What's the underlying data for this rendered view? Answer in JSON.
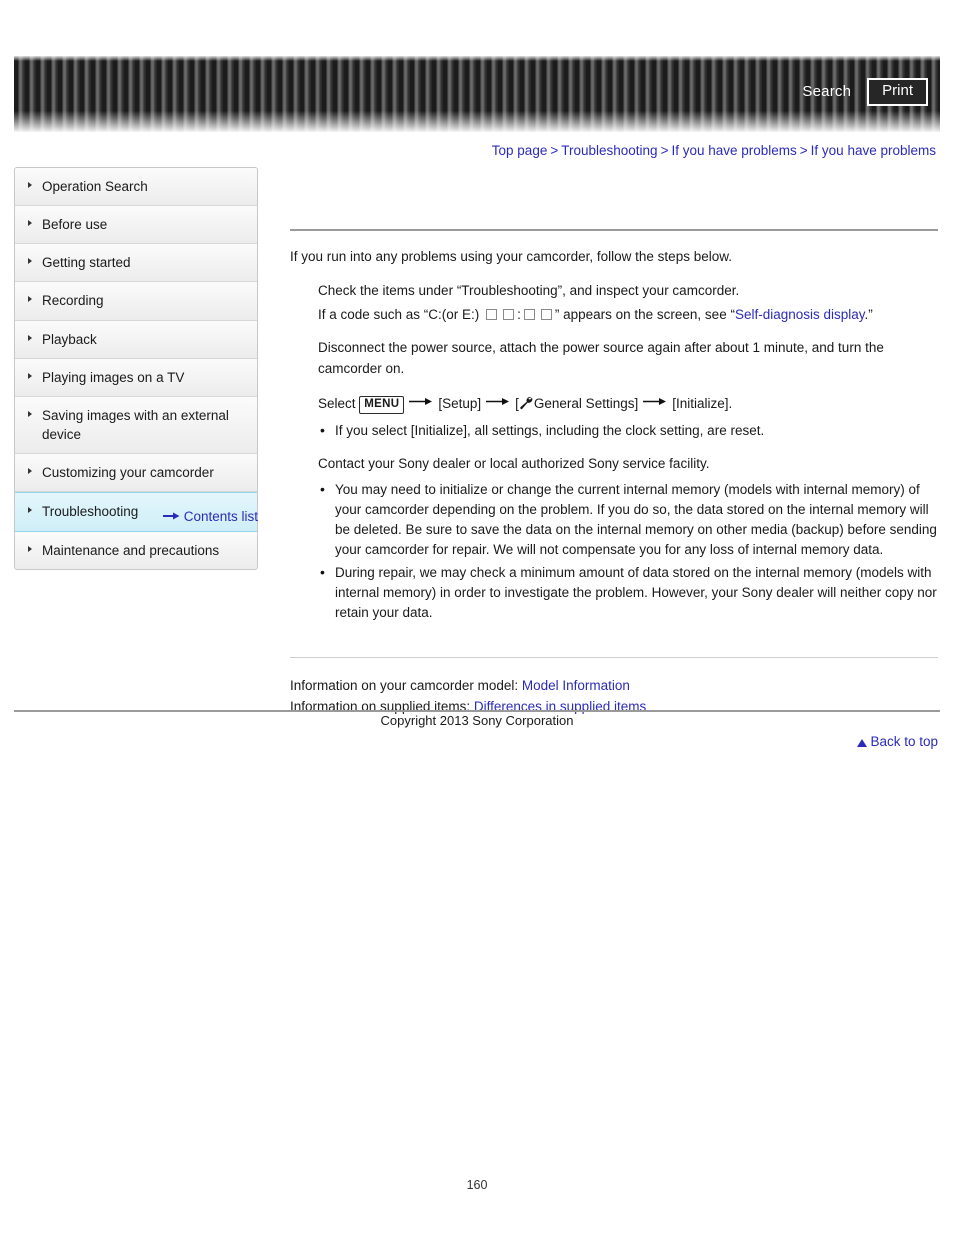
{
  "header": {
    "search_label": "Search",
    "print_label": "Print"
  },
  "breadcrumb": {
    "items": [
      "Top page",
      "Troubleshooting",
      "If you have problems",
      "If you have problems"
    ],
    "separator": ">"
  },
  "sidebar": {
    "items": [
      {
        "label": "Operation Search",
        "active": false
      },
      {
        "label": "Before use",
        "active": false
      },
      {
        "label": "Getting started",
        "active": false
      },
      {
        "label": "Recording",
        "active": false
      },
      {
        "label": "Playback",
        "active": false
      },
      {
        "label": "Playing images on a TV",
        "active": false
      },
      {
        "label": "Saving images with an external device",
        "active": false
      },
      {
        "label": "Customizing your camcorder",
        "active": false
      },
      {
        "label": "Troubleshooting",
        "active": true
      },
      {
        "label": "Maintenance and precautions",
        "active": false
      }
    ],
    "contents_list_label": "Contents list"
  },
  "main": {
    "intro": "If you run into any problems using your camcorder, follow the steps below.",
    "step1_line1": "Check the items under “Troubleshooting”, and inspect your camcorder.",
    "step1_line2_prefix": "If a code such as “C:(or E:)",
    "step1_line2_colon": ":",
    "step1_line2_mid": "” appears on the screen, see “",
    "step1_link": "Self-diagnosis display",
    "step1_line2_suffix": ".”",
    "step2": "Disconnect the power source, attach the power source again after about 1 minute, and turn the camcorder on.",
    "step3_select": "Select",
    "step3_menu_chip": "MENU",
    "step3_setup": "[Setup]",
    "step3_general": "General Settings]",
    "step3_general_open": "[",
    "step3_initialize": "[Initialize].",
    "step3_note": "If you select [Initialize], all settings, including the clock setting, are reset.",
    "step4": "Contact your Sony dealer or local authorized Sony service facility.",
    "step4_note1": "You may need to initialize or change the current internal memory (models with internal memory) of your camcorder depending on the problem. If you do so, the data stored on the internal memory will be deleted. Be sure to save the data on the internal memory on other media (backup) before sending your camcorder for repair. We will not compensate you for any loss of internal memory data.",
    "step4_note2": "During repair, we may check a minimum amount of data stored on the internal memory (models with internal memory) in order to investigate the problem. However, your Sony dealer will neither copy nor retain your data.",
    "info_model_label": "Information on your camcorder model:",
    "info_model_link": "Model Information",
    "info_supplied_label": "Information on supplied items:",
    "info_supplied_link": "Differences in supplied items",
    "back_to_top": "Back to top"
  },
  "footer": {
    "copyright": "Copyright 2013 Sony Corporation",
    "page_number": "160"
  },
  "colors": {
    "link": "#2b2bbb",
    "active_nav": "#cfeef7",
    "rule": "#9a9a9a"
  }
}
